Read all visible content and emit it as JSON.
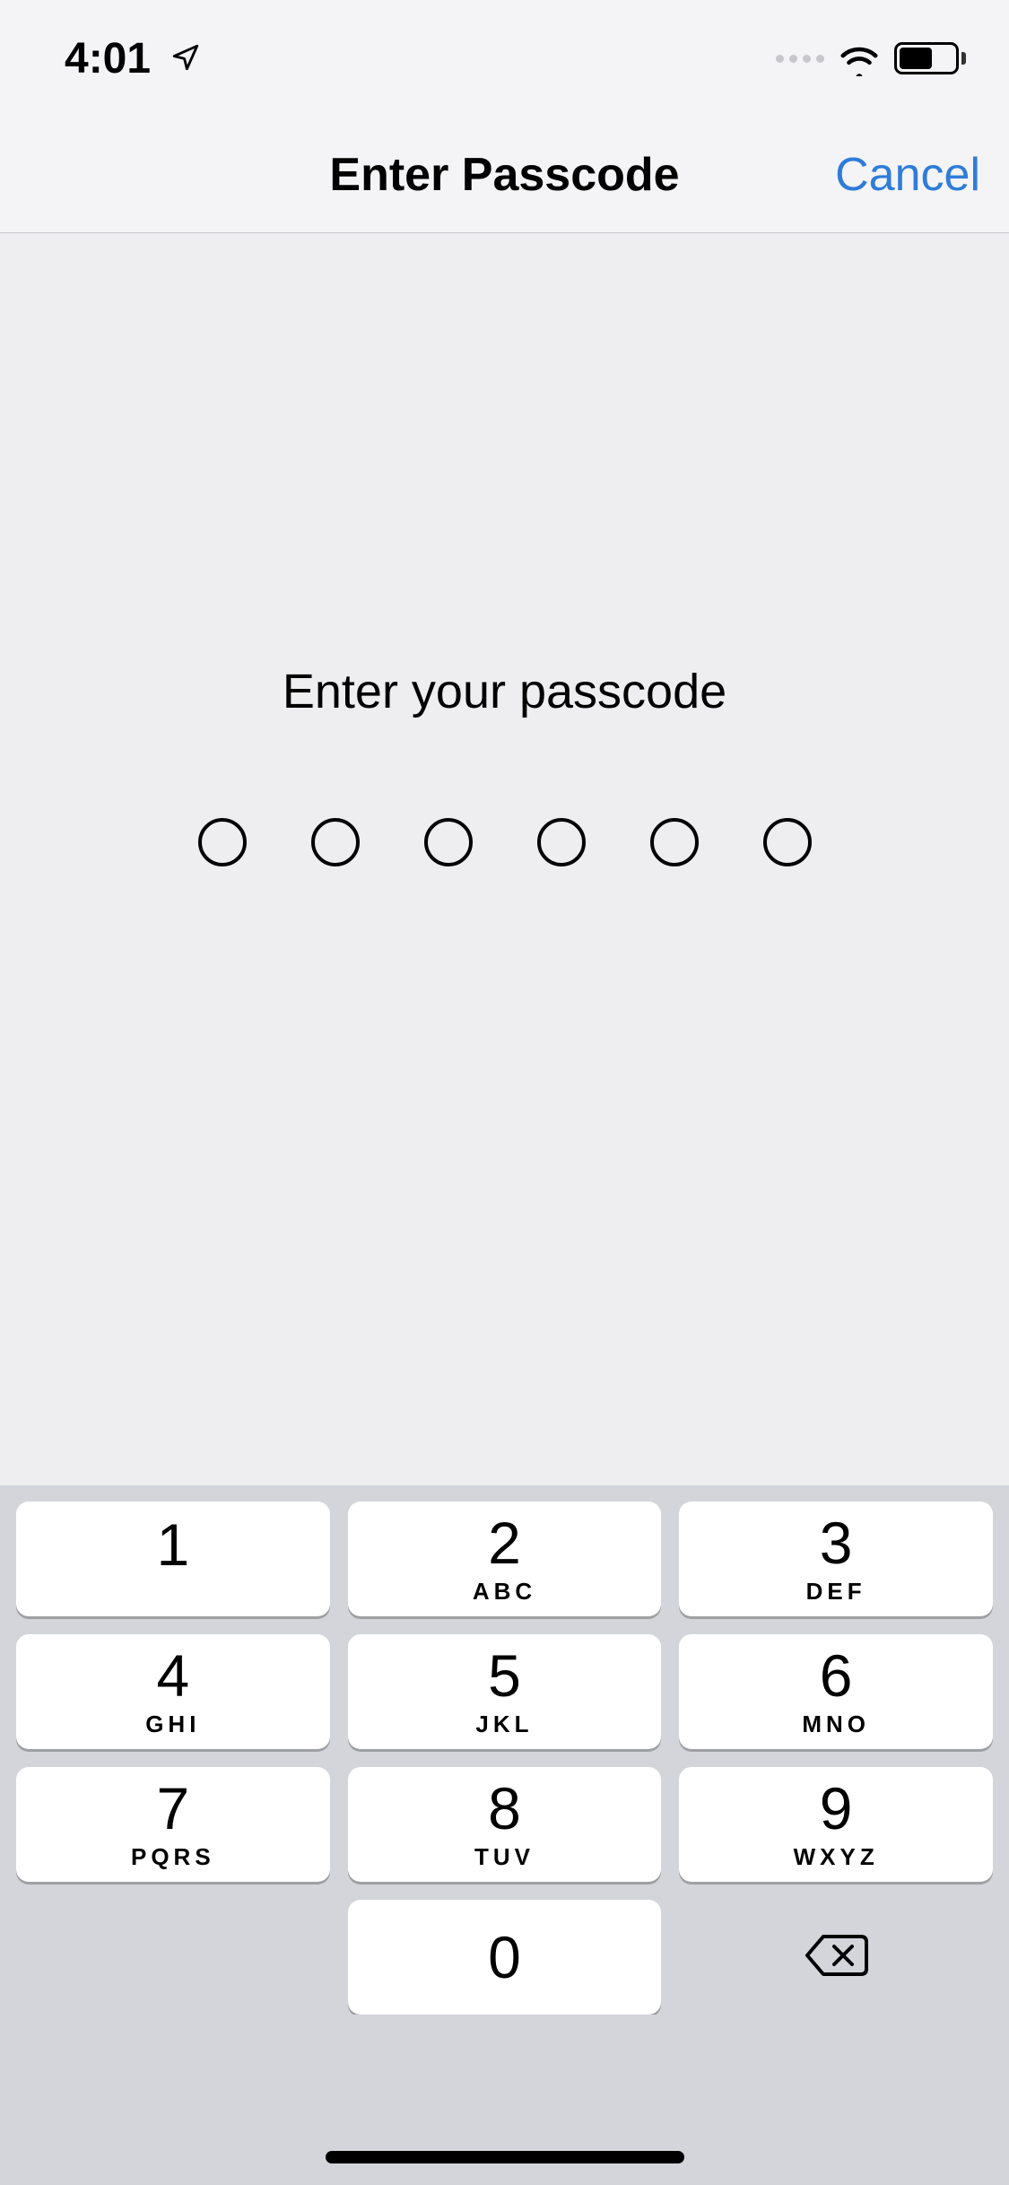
{
  "status": {
    "time": "4:01",
    "location_icon": "location-arrow-icon"
  },
  "nav": {
    "title": "Enter Passcode",
    "cancel": "Cancel"
  },
  "content": {
    "prompt": "Enter your passcode",
    "passcode_length": 6,
    "entered": 0
  },
  "keypad": {
    "keys": [
      {
        "digit": "1",
        "letters": ""
      },
      {
        "digit": "2",
        "letters": "ABC"
      },
      {
        "digit": "3",
        "letters": "DEF"
      },
      {
        "digit": "4",
        "letters": "GHI"
      },
      {
        "digit": "5",
        "letters": "JKL"
      },
      {
        "digit": "6",
        "letters": "MNO"
      },
      {
        "digit": "7",
        "letters": "PQRS"
      },
      {
        "digit": "8",
        "letters": "TUV"
      },
      {
        "digit": "9",
        "letters": "WXYZ"
      },
      {
        "digit": "0",
        "letters": ""
      }
    ]
  },
  "colors": {
    "accent": "#2f7cd9",
    "keypad_bg": "#d3d5da",
    "content_bg": "#eeeef0",
    "header_bg": "#f4f4f6"
  }
}
